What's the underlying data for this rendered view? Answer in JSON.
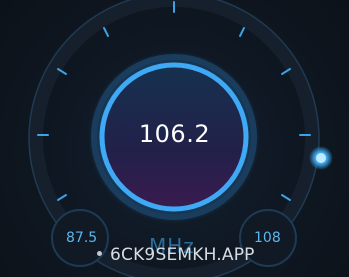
{
  "tuner": {
    "frequency": "106.2",
    "unit": "MHz",
    "min": "87.5",
    "max": "108",
    "level_fraction": 0.9
  },
  "watermark": {
    "text": "6CK9SEMKH.APP"
  },
  "colors": {
    "background": "#0e141c",
    "accent": "#3fa9f5",
    "knob_top": "#16314f",
    "knob_bottom": "#3a1b4f",
    "label": "#5ab6ee"
  }
}
